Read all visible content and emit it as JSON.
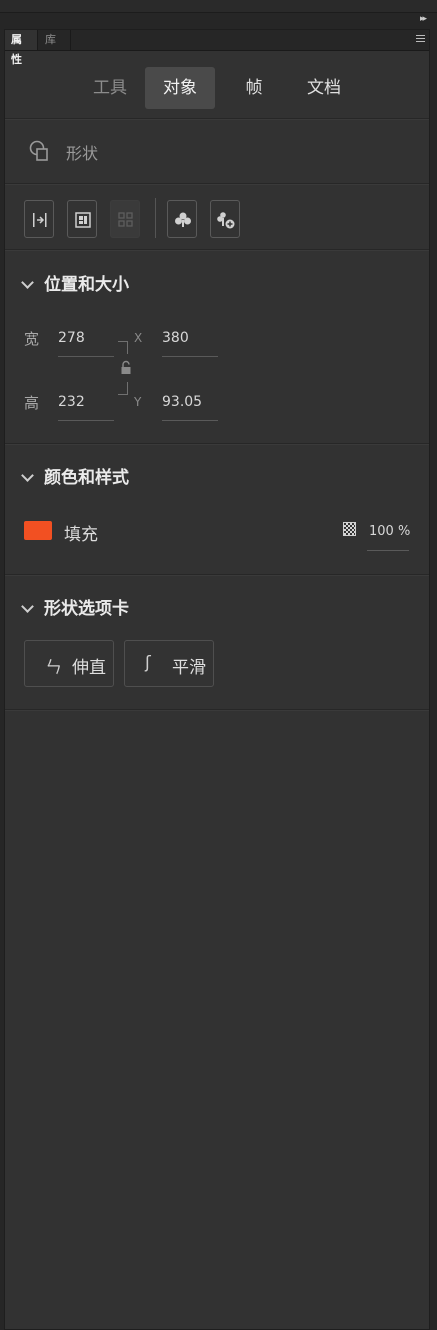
{
  "panel": {
    "tabs": [
      {
        "label": "属性",
        "active": true
      },
      {
        "label": "库",
        "active": false
      }
    ],
    "collapse_glyph": "▸▸",
    "menu_icon": "hamburger-icon"
  },
  "mode_tabs": [
    {
      "label": "工具",
      "state": "dim"
    },
    {
      "label": "对象",
      "state": "selected"
    },
    {
      "label": "帧",
      "state": "normal"
    },
    {
      "label": "文档",
      "state": "normal"
    }
  ],
  "object": {
    "type_label": "形状",
    "type_icon": "shape-icon"
  },
  "toolbar": {
    "buttons": [
      {
        "icon": "align-icon",
        "enabled": true
      },
      {
        "icon": "fit-frame-icon",
        "enabled": true
      },
      {
        "icon": "distribute-icon",
        "enabled": false
      },
      {
        "icon": "convert-symbol-icon",
        "enabled": true
      },
      {
        "icon": "add-symbol-icon",
        "enabled": true
      }
    ]
  },
  "position_size": {
    "title": "位置和大小",
    "width_label": "宽",
    "width": "278",
    "height_label": "高",
    "height": "232",
    "x_label": "X",
    "x": "380",
    "y_label": "Y",
    "y": "93.05"
  },
  "color_style": {
    "title": "颜色和样式",
    "fill_label": "填充",
    "fill_color": "#f25022",
    "opacity": "100 %"
  },
  "shape_options": {
    "title": "形状选项卡",
    "buttons": [
      {
        "glyph": "ㄣ",
        "label": "伸直"
      },
      {
        "glyph": "ʃ",
        "label": "平滑"
      }
    ]
  }
}
